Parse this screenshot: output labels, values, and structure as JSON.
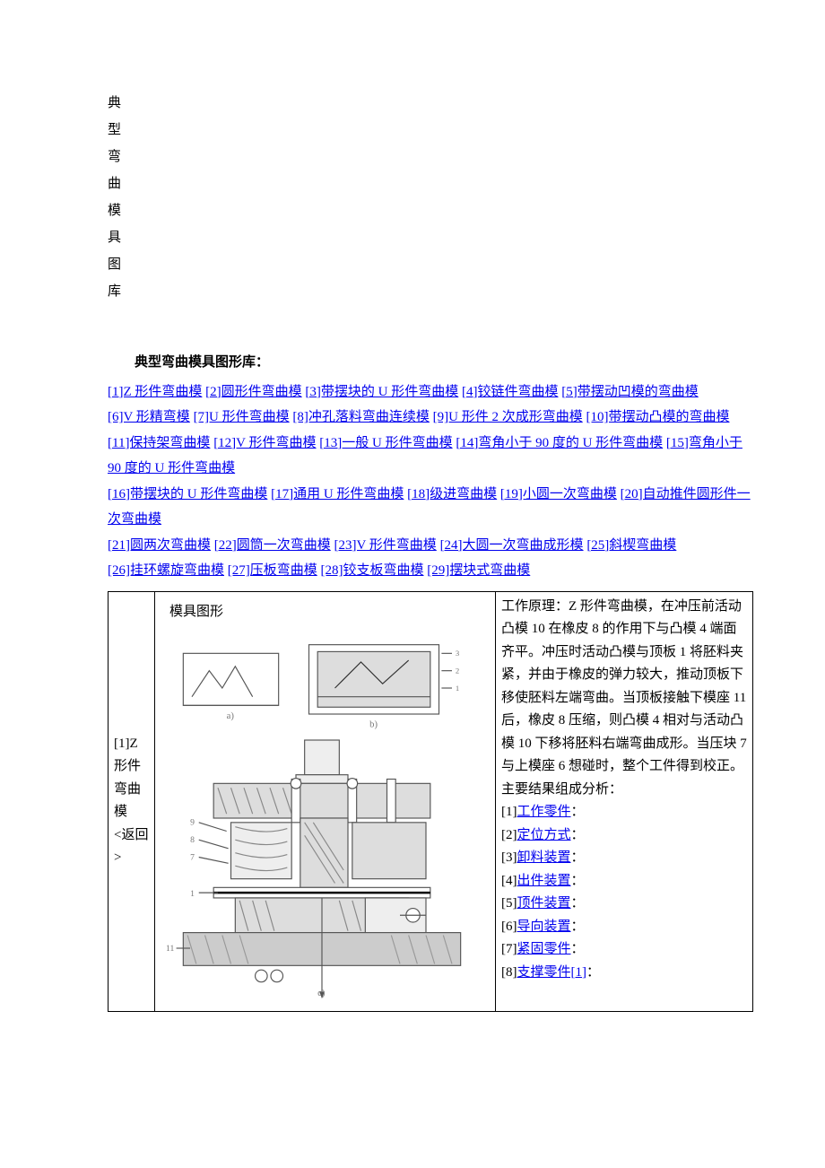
{
  "vertical_title": [
    "典",
    "型",
    "弯",
    "曲",
    "模",
    "具",
    "图",
    "库"
  ],
  "subtitle": "典型弯曲模具图形库：",
  "index": {
    "l1": "[1]Z 形件弯曲模",
    "l2": "[2]圆形件弯曲模",
    "l3": "[3]带摆块的 U 形件弯曲模",
    "l4": "[4]铰链件弯曲模",
    "l5": "[5]带摆动凹模的弯曲模",
    "l6": "[6]V 形精弯模",
    "l7": "[7]U 形件弯曲模",
    "l8": "[8]冲孔落料弯曲连续模",
    "l9": "[9]U 形件 2 次成形弯曲模",
    "l10": "[10]带摆动凸模的弯曲模",
    "l11": "[11]保持架弯曲模",
    "l12": "[12]V 形件弯曲模",
    "l13": "[13]一般 U 形件弯曲模",
    "l14": "[14]弯角小于 90 度的 U 形件弯曲模",
    "l15": "[15]弯角小于 90 度的 U 形件弯曲模",
    "l16": "[16]带摆块的 U 形件弯曲模",
    "l17": "[17]通用 U 形件弯曲模",
    "l18": "[18]级进弯曲模",
    "l19": "[19]小圆一次弯曲模",
    "l20": "[20]自动推件圆形件一次弯曲模",
    "l21": "[21]圆两次弯曲模",
    "l22": "[22]圆筒一次弯曲模",
    "l23": "[23]V 形件弯曲模",
    "l24": "[24]大圆一次弯曲成形模",
    "l25": "[25]斜楔弯曲模",
    "l26": "[26]挂环螺旋弯曲模",
    "l27": "[27]压板弯曲模",
    "l28": "[28]铰支板弯曲模",
    "l29": "[29]摆块式弯曲模"
  },
  "content": {
    "row1": {
      "label_a": "[1]Z",
      "label_b": "形件",
      "label_c": "弯曲",
      "label_d": "模",
      "back": "<返回>",
      "fig_title": "模具图形",
      "principle": "工作原理：Z 形件弯曲模，在冲压前活动凸模 10 在橡皮 8 的作用下与凸模 4 端面齐平。冲压时活动凸模与顶板 1 将胚料夹紧，并由于橡皮的弹力较大，推动顶板下移使胚料左端弯曲。当顶板接触下模座 11 后，橡皮 8 压缩，则凸模 4 相对与活动凸模 10 下移将胚料右端弯曲成形。当压块 7 与上模座 6 想碰时，整个工件得到校正。",
      "analysis_title": "主要结果组成分析：",
      "items": {
        "n1": "[1]",
        "t1": "工作零件",
        "n2": "[2]",
        "t2": "定位方式",
        "n3": "[3]",
        "t3": "卸料装置",
        "n4": "[4]",
        "t4": "出件装置",
        "n5": "[5]",
        "t5": "顶件装置",
        "n6": "[6]",
        "t6": "导向装置",
        "n7": "[7]",
        "t7": "紧固零件",
        "n8": "[8]",
        "t8": "支撑零件[1]"
      },
      "colon": "："
    }
  }
}
